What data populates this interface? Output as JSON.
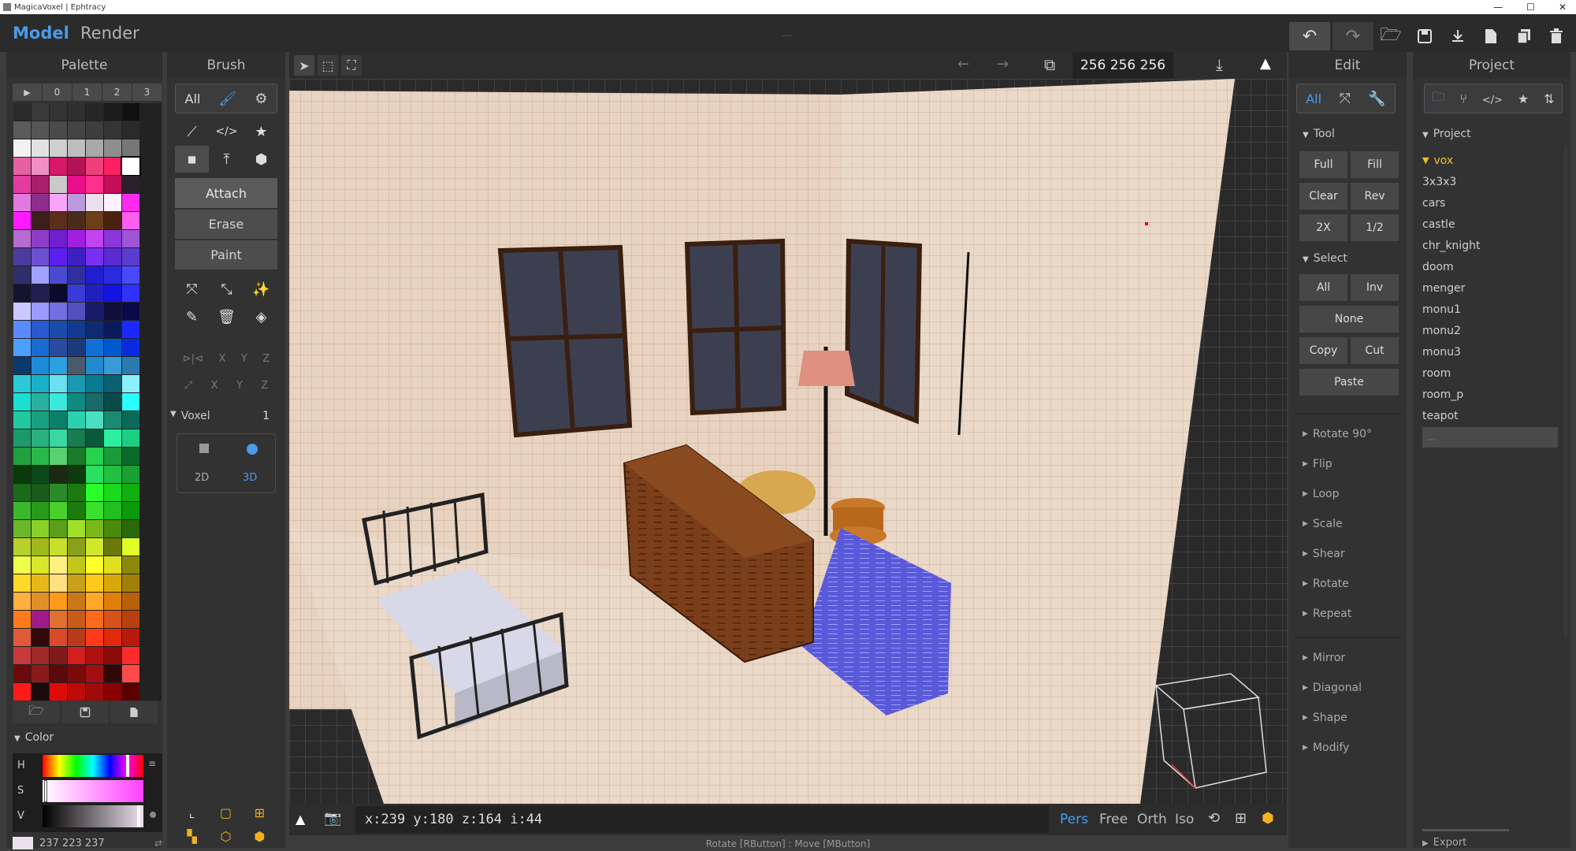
{
  "window": {
    "title": "MagicaVoxel | Ephtracy",
    "controls": [
      "—",
      "☐",
      "✕"
    ]
  },
  "modes": {
    "model": "Model",
    "render": "Render"
  },
  "grip": "....",
  "palette": {
    "title": "Palette",
    "tabs": [
      "▶",
      "0",
      "1",
      "2",
      "3"
    ],
    "selected_index": 27,
    "colors": [
      "#2a2a2a",
      "#3a3a3a",
      "#333333",
      "#2f2f2f",
      "#262626",
      "#1b1b1b",
      "#111111",
      "#5a5a5a",
      "#555555",
      "#4a4a4a",
      "#444444",
      "#3d3d3d",
      "#353535",
      "#2a2a2a",
      "#f2f2f2",
      "#e2e2e2",
      "#cfcfcf",
      "#bdbdbd",
      "#a9a9a9",
      "#8e8e8e",
      "#777777",
      "#e65fa3",
      "#f08fc4",
      "#d6186a",
      "#b01454",
      "#ee3f7a",
      "#ff1f62",
      "#ffffff",
      "#e23ca0",
      "#a81f6c",
      "#c9c9c9",
      "#e80f8a",
      "#ff2f8c",
      "#c20f58",
      "#2a1f2a",
      "#e07ae0",
      "#8c2e8c",
      "#f7a6f7",
      "#b9d",
      "#ede0ed",
      "#fff0ff",
      "#ff2aee",
      "#ff1aff",
      "#3a1f1a",
      "#5a2e1a",
      "#4a2a1a",
      "#6b3f1a",
      "#4a2010",
      "#ff5cf0",
      "#b76ad0",
      "#8f3cc7",
      "#6f1fd0",
      "#a21fe0",
      "#c243f0",
      "#8a36d8",
      "#a054d8",
      "#4d3a9f",
      "#6c4fd2",
      "#5c1ff0",
      "#3d1fc2",
      "#7a2ff0",
      "#5b2ad0",
      "#5a3cd0",
      "#2e2e6a",
      "#a1a1ff",
      "#4a4ad0",
      "#2f2fa0",
      "#1f1fd0",
      "#2a2ae0",
      "#4848ff",
      "#141432",
      "#1e1e50",
      "#0a0a2a",
      "#3a3ad8",
      "#2020c0",
      "#1414e0",
      "#3030ff",
      "#c9c9ff",
      "#9a9aff",
      "#7070e0",
      "#5050c0",
      "#1a1a6a",
      "#0f0f3a",
      "#0a0a4a",
      "#5a8aff",
      "#2a5ad0",
      "#1a4aaa",
      "#123a90",
      "#0e2a70",
      "#0a1a5a",
      "#1a2aff",
      "#4aa0ff",
      "#1a6ad0",
      "#2a4aa0",
      "#1a3a7a",
      "#1070d8",
      "#005acf",
      "#0a2ae0",
      "#0a3a6a",
      "#1f8ad8",
      "#2aa0e0",
      "#4a5a6a",
      "#208ad0",
      "#3a9ad8",
      "#2a7ab0",
      "#2ac8d8",
      "#1ab0c8",
      "#6ae0f0",
      "#1a9ab0",
      "#0a7a90",
      "#086070",
      "#8af0ff",
      "#1adfd0",
      "#2ab0a0",
      "#3ae8e0",
      "#0e8a80",
      "#1a6a6a",
      "#0a4a4a",
      "#2affff",
      "#20c8a0",
      "#1aa080",
      "#0a806a",
      "#2ad0b0",
      "#48e0c0",
      "#1a8a70",
      "#0a6a5a",
      "#1a9a6a",
      "#2ab080",
      "#3ad8a0",
      "#1a7a50",
      "#0a5a3a",
      "#2af0a0",
      "#1ad080",
      "#20a040",
      "#2ab84a",
      "#5ad070",
      "#1a7a2a",
      "#2ad050",
      "#1a9a3a",
      "#0a6a2a",
      "#0a3a0a",
      "#0a4a1a",
      "#1a2a10",
      "#0e3a0e",
      "#2ae060",
      "#20c040",
      "#1aa030",
      "#1a6a1a",
      "#1a5a1a",
      "#2a8a2a",
      "#1a7a10",
      "#2aff2a",
      "#1ad81a",
      "#10b010",
      "#3ab82a",
      "#2a9a1a",
      "#4ad02a",
      "#1a7a0a",
      "#3ae02a",
      "#20c020",
      "#0a9a0a",
      "#6ab82a",
      "#8ad02a",
      "#5aa01a",
      "#a0e02a",
      "#7ab81a",
      "#4a8a0a",
      "#2a6a0a",
      "#b8d02a",
      "#a0b81a",
      "#c8e02a",
      "#8aa01a",
      "#d0e82a",
      "#6a7a0a",
      "#e0ff2a",
      "#f0ff4a",
      "#d8e82a",
      "#fff080",
      "#c0c81a",
      "#ffff2a",
      "#e0e020",
      "#8a8a0a",
      "#ffd82a",
      "#e8b81a",
      "#ffe080",
      "#c8a01a",
      "#ffc81a",
      "#d8a80a",
      "#a0800a",
      "#ffb040",
      "#e0902a",
      "#ff9a1a",
      "#c87a1a",
      "#ffa82a",
      "#e0800a",
      "#b8600a",
      "#ff7a1a",
      "#a01a8a",
      "#e07030",
      "#c85a1a",
      "#ff6a1a",
      "#d8501a",
      "#b8400a",
      "#e05a3a",
      "#300a0a",
      "#d84a2a",
      "#b83a1a",
      "#ff3a1a",
      "#e02a0a",
      "#b81a0a",
      "#c83a3a",
      "#a02a2a",
      "#801a1a",
      "#d02020",
      "#b01010",
      "#8a0a0a",
      "#ff2a2a",
      "#6a0a0a",
      "#8a1a1a",
      "#5a0a0a",
      "#7a0a0a",
      "#a01010",
      "#300808",
      "#ff4a4a",
      "#ff1a1a",
      "#1a0a0a",
      "#e00a0a",
      "#c00a0a",
      "#a00a0a",
      "#8a0000",
      "#5a0000"
    ],
    "footer_icons": [
      "folder-open-icon",
      "save-icon",
      "file-icon"
    ]
  },
  "color": {
    "title": "Color",
    "h_label": "H",
    "s_label": "S",
    "v_label": "V",
    "current": "#ede0ed",
    "rgb_text": "237  223  237"
  },
  "brush": {
    "title": "Brush",
    "all_label": "All",
    "modes": {
      "attach": "Attach",
      "erase": "Erase",
      "paint": "Paint"
    },
    "axis_rows": [
      [
        "X",
        "Y",
        "Z"
      ],
      [
        "X",
        "Y",
        "Z"
      ]
    ],
    "voxel": {
      "title": "Voxel",
      "count": "1",
      "opt2d": "2D",
      "opt3d": "3D"
    }
  },
  "viewport": {
    "dims": "256  256  256",
    "status": "x:239  y:180  z:164  i:44",
    "views": {
      "pers": "Pers",
      "free": "Free",
      "orth": "Orth",
      "iso": "Iso"
    },
    "hint": "Rotate [RButton] : Move [MButton]"
  },
  "edit": {
    "title": "Edit",
    "tool": {
      "title": "Tool",
      "full": "Full",
      "fill": "Fill",
      "clear": "Clear",
      "rev": "Rev",
      "x2": "2X",
      "half": "1/2"
    },
    "select": {
      "title": "Select",
      "all": "All",
      "inv": "Inv",
      "none": "None",
      "copy": "Copy",
      "cut": "Cut",
      "paste": "Paste"
    },
    "collapsed": [
      "Rotate 90°",
      "Flip",
      "Loop",
      "Scale",
      "Shear",
      "Rotate",
      "Repeat"
    ],
    "collapsed2": [
      "Mirror",
      "Diagonal",
      "Shape",
      "Modify"
    ]
  },
  "project": {
    "title": "Project",
    "section": "Project",
    "folder": "vox",
    "files": [
      "3x3x3",
      "cars",
      "castle",
      "chr_knight",
      "doom",
      "menger",
      "monu1",
      "monu2",
      "monu3",
      "room",
      "room_p",
      "teapot"
    ],
    "new_input": "...",
    "export": "Export"
  },
  "accent": "#4a9be8"
}
